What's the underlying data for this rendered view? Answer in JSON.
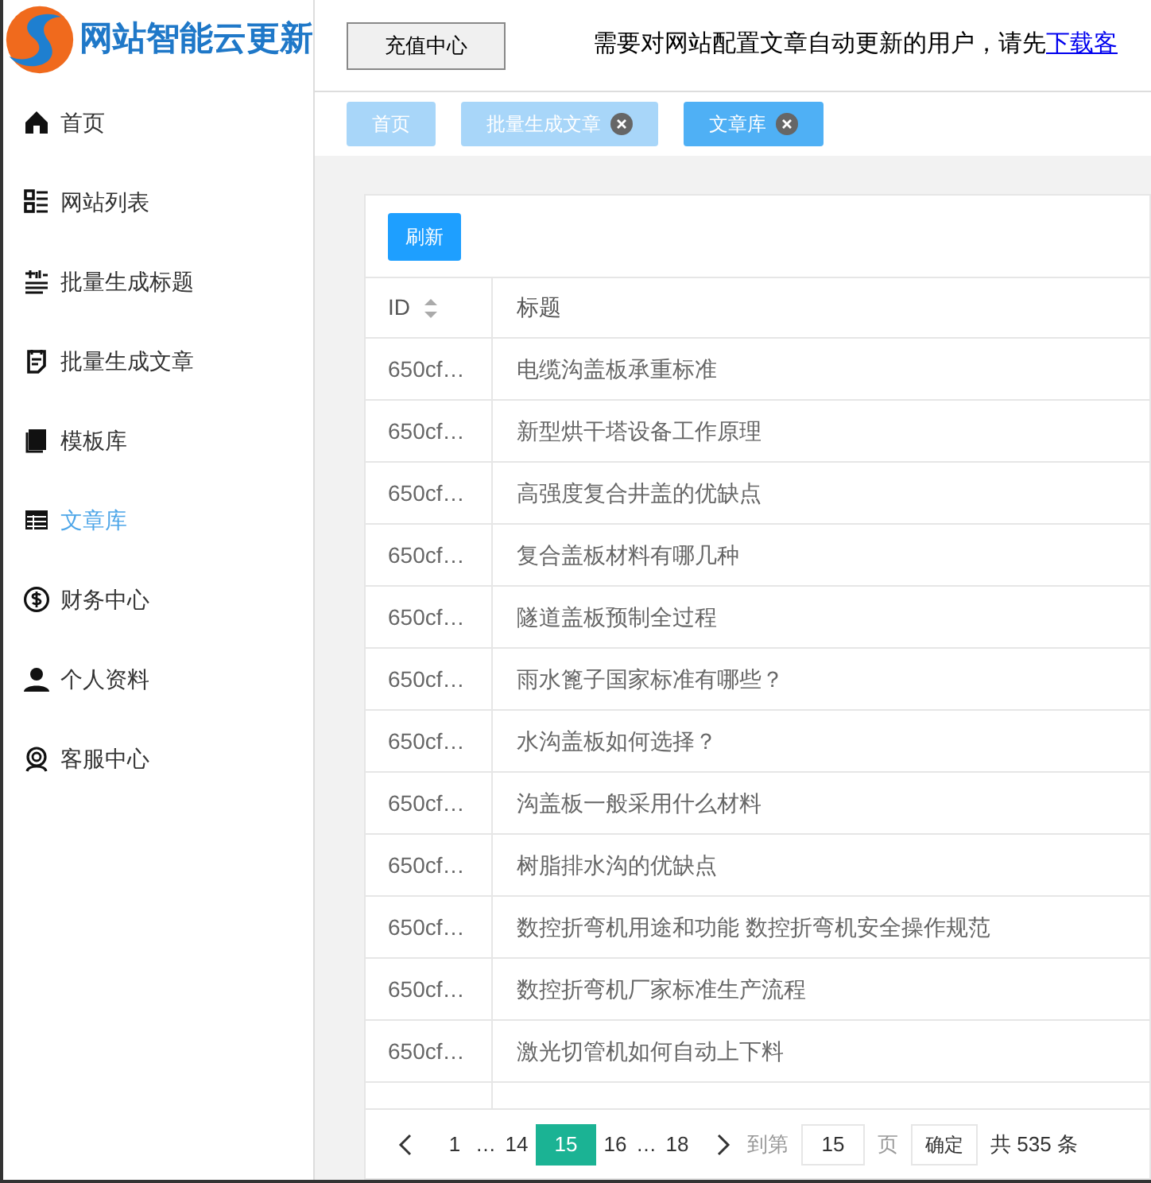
{
  "logo": {
    "title": "网站智能云更新"
  },
  "sidebar": {
    "items": [
      {
        "label": "首页",
        "kind": "home",
        "selected": false
      },
      {
        "label": "网站列表",
        "kind": "list",
        "selected": false
      },
      {
        "label": "批量生成标题",
        "kind": "title",
        "selected": false
      },
      {
        "label": "批量生成文章",
        "kind": "doc",
        "selected": false
      },
      {
        "label": "模板库",
        "kind": "book",
        "selected": false
      },
      {
        "label": "文章库",
        "kind": "table",
        "selected": true
      },
      {
        "label": "财务中心",
        "kind": "money",
        "selected": false
      },
      {
        "label": "个人资料",
        "kind": "user",
        "selected": false
      },
      {
        "label": "客服中心",
        "kind": "support",
        "selected": false
      }
    ]
  },
  "header": {
    "recharge_button": "充值中心",
    "notice": "需要对网站配置文章自动更新的用户，请先",
    "notice_link": "下载客"
  },
  "tabs": [
    {
      "label": "首页",
      "closable": false,
      "selected": false
    },
    {
      "label": "批量生成文章",
      "closable": true,
      "selected": false
    },
    {
      "label": "文章库",
      "closable": true,
      "selected": true
    }
  ],
  "refresh_button": "刷新",
  "table": {
    "columns": [
      "ID",
      "标题"
    ],
    "rows": [
      [
        "650cf…",
        "电缆沟盖板承重标准"
      ],
      [
        "650cf…",
        "新型烘干塔设备工作原理"
      ],
      [
        "650cf…",
        "高强度复合井盖的优缺点"
      ],
      [
        "650cf…",
        "复合盖板材料有哪几种"
      ],
      [
        "650cf…",
        "隧道盖板预制全过程"
      ],
      [
        "650cf…",
        "雨水篦子国家标准有哪些？"
      ],
      [
        "650cf…",
        "水沟盖板如何选择？"
      ],
      [
        "650cf…",
        "沟盖板一般采用什么材料"
      ],
      [
        "650cf…",
        "树脂排水沟的优缺点"
      ],
      [
        "650cf…",
        "数控折弯机用途和功能 数控折弯机安全操作规范"
      ],
      [
        "650cf…",
        "数控折弯机厂家标准生产流程"
      ],
      [
        "650cf…",
        "激光切管机如何自动上下料"
      ]
    ]
  },
  "pagination": {
    "pages": [
      {
        "label": "1",
        "kind": "page",
        "selected": false
      },
      {
        "label": "…",
        "kind": "gap"
      },
      {
        "label": "14",
        "kind": "page",
        "selected": false
      },
      {
        "label": "15",
        "kind": "page",
        "selected": true
      },
      {
        "label": "16",
        "kind": "page",
        "selected": false
      },
      {
        "label": "…",
        "kind": "gap"
      },
      {
        "label": "18",
        "kind": "page",
        "selected": false
      }
    ],
    "goto_label": "到第",
    "goto_value": "15",
    "page_unit": "页",
    "confirm_button": "确定",
    "total": "共 535 条"
  }
}
